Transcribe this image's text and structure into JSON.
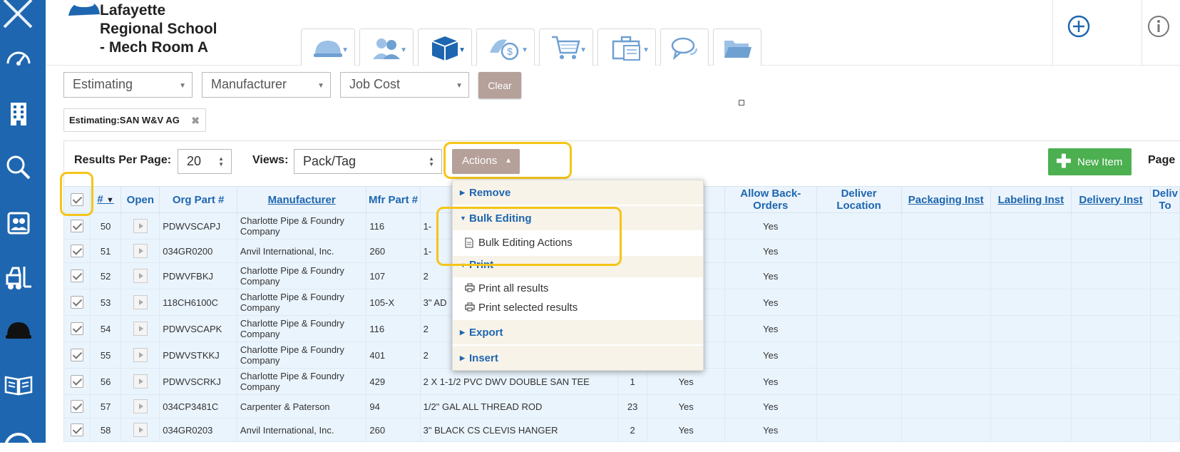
{
  "header": {
    "title_lines": [
      "Lafayette",
      "Regional School",
      "- Mech Room A"
    ],
    "tabs": [
      {
        "icon": "hardhat-icon"
      },
      {
        "icon": "workers-icon"
      },
      {
        "icon": "box-icon"
      },
      {
        "icon": "money-icon"
      },
      {
        "icon": "cart-icon"
      },
      {
        "icon": "briefcase-icon"
      },
      {
        "icon": "chat-icon"
      },
      {
        "icon": "folder-icon"
      }
    ]
  },
  "filters": {
    "estimating": "Estimating",
    "manufacturer": "Manufacturer",
    "job_cost": "Job Cost",
    "clear": "Clear",
    "chip_label": "Estimating:",
    "chip_value": "SAN W&V AG"
  },
  "toolbar": {
    "results_label": "Results Per Page:",
    "results_value": "20",
    "views_label": "Views:",
    "views_value": "Pack/Tag",
    "actions": "Actions",
    "new_item": "New Item",
    "page_label": "Page"
  },
  "menu": {
    "remove": "Remove",
    "bulk_editing": "Bulk Editing",
    "bulk_editing_actions": "Bulk Editing Actions",
    "print": "Print",
    "print_all": "Print all results",
    "print_selected": "Print selected results",
    "export": "Export",
    "insert": "Insert"
  },
  "table": {
    "headers": {
      "num": "#",
      "open": "Open",
      "org_part": "Org Part #",
      "manufacturer": "Manufacturer",
      "mfr_part": "Mfr Part #",
      "allow_back": "Allow Back-Orders",
      "deliver_location": "Deliver Location",
      "packaging": "Packaging Inst",
      "labeling": "Labeling Inst",
      "delivery": "Delivery Inst",
      "deliv_to": "Deliv To"
    },
    "rows": [
      {
        "num": "50",
        "org": "PDWVSCAPJ",
        "mfr": "Charlotte Pipe & Foundry Company",
        "mfr_part": "116",
        "desc": "1-",
        "qty": "",
        "col7": "",
        "back": "Yes"
      },
      {
        "num": "51",
        "org": "034GR0200",
        "mfr": "Anvil International, Inc.",
        "mfr_part": "260",
        "desc": "1-",
        "qty": "",
        "col7": "",
        "back": "Yes"
      },
      {
        "num": "52",
        "org": "PDWVFBKJ",
        "mfr": "Charlotte Pipe & Foundry Company",
        "mfr_part": "107",
        "desc": "2",
        "qty": "",
        "col7": "",
        "back": "Yes"
      },
      {
        "num": "53",
        "org": "118CH6100C",
        "mfr": "Charlotte Pipe & Foundry Company",
        "mfr_part": "105-X",
        "desc": "3\" AD",
        "qty": "",
        "col7": "",
        "back": "Yes"
      },
      {
        "num": "54",
        "org": "PDWVSCAPK",
        "mfr": "Charlotte Pipe & Foundry Company",
        "mfr_part": "116",
        "desc": "2",
        "qty": "",
        "col7": "",
        "back": "Yes"
      },
      {
        "num": "55",
        "org": "PDWVSTKKJ",
        "mfr": "Charlotte Pipe & Foundry Company",
        "mfr_part": "401",
        "desc": "2",
        "qty": "",
        "col7": "",
        "back": "Yes"
      },
      {
        "num": "56",
        "org": "PDWVSCRKJ",
        "mfr": "Charlotte Pipe & Foundry Company",
        "mfr_part": "429",
        "desc": "2 X 1-1/2 PVC DWV DOUBLE SAN TEE",
        "qty": "1",
        "col7": "Yes",
        "back": "Yes"
      },
      {
        "num": "57",
        "org": "034CP3481C",
        "mfr": "Carpenter & Paterson",
        "mfr_part": "94",
        "desc": "1/2\" GAL ALL THREAD ROD",
        "qty": "23",
        "col7": "Yes",
        "back": "Yes"
      },
      {
        "num": "58",
        "org": "034GR0203",
        "mfr": "Anvil International, Inc.",
        "mfr_part": "260",
        "desc": "3\" BLACK CS CLEVIS HANGER",
        "qty": "2",
        "col7": "Yes",
        "back": "Yes"
      }
    ]
  },
  "colors": {
    "sidebar": "#1e66b0",
    "highlight": "#f5c518",
    "action_button": "#b5a09a",
    "new_item": "#4caf50",
    "table_header_text": "#1e66b0",
    "row_bg": "#eaf4fd"
  }
}
